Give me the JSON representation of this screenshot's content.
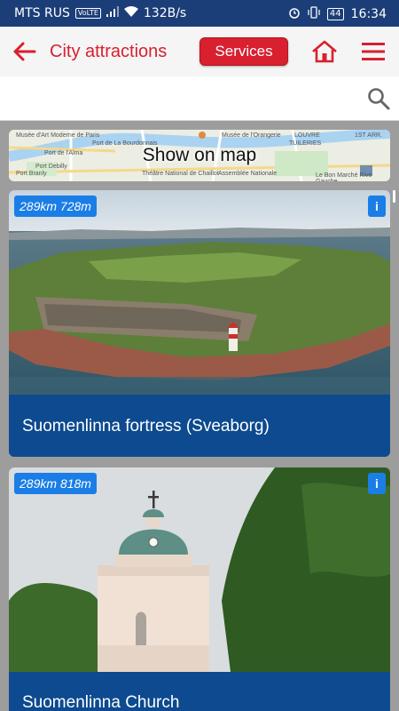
{
  "status": {
    "carrier": "MTS RUS",
    "volte": "VoLTE",
    "speed": "132B/s",
    "battery": "44",
    "time": "16:34"
  },
  "header": {
    "title": "City attractions",
    "services_label": "Services",
    "accent": "#d8202f"
  },
  "search": {
    "placeholder": "",
    "value": ""
  },
  "map": {
    "label": "Show on map",
    "places": [
      "Musée d'Art Moderne de Paris",
      "Port de l'Alma",
      "Port Debilly",
      "Théâtre National de Chaillot",
      "Musée de l'Orangerie",
      "LOUVRE",
      "TUILERIES",
      "1ST ARR.",
      "Assemblée Nationale",
      "Port Branly",
      "Port de La Bourdonnais",
      "Le Bon Marché Rive Gauche"
    ]
  },
  "attractions": [
    {
      "distance": "289km 728m",
      "title": "Suomenlinna fortress (Sveaborg)",
      "info": "i"
    },
    {
      "distance": "289km 818m",
      "title": "Suomenlinna Church",
      "info": "i"
    }
  ]
}
